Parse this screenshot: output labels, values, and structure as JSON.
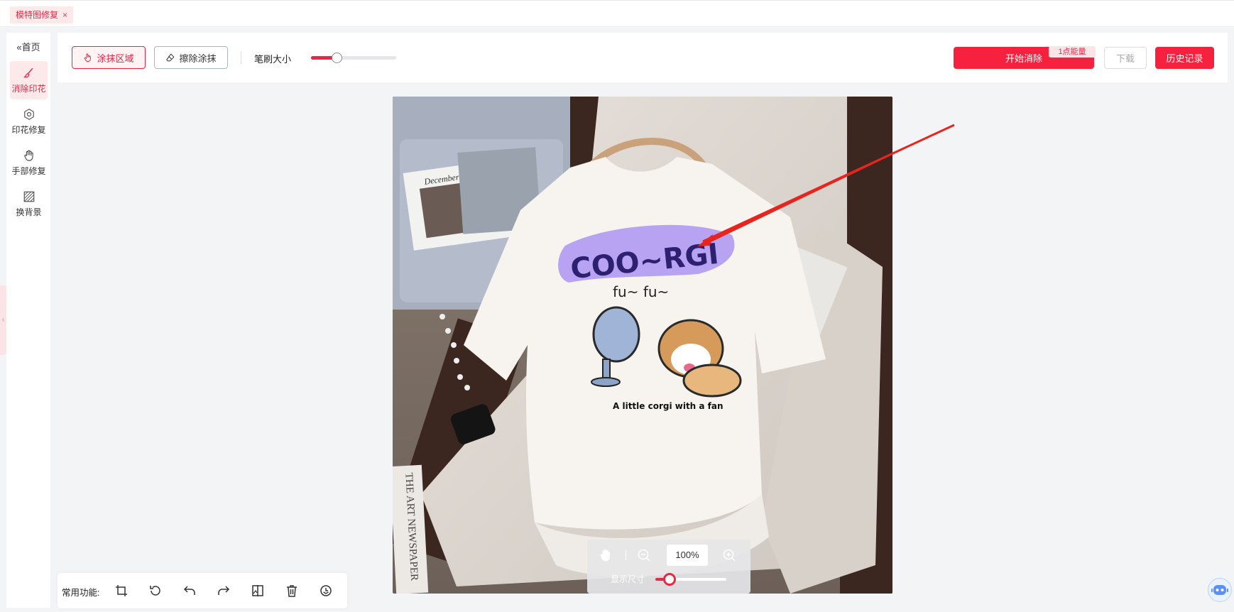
{
  "tabs": [
    {
      "label": "模特图修复",
      "close": "×"
    }
  ],
  "sidebar": {
    "home_label": "首页",
    "home_icon": "double-chevron-left-icon",
    "items": [
      {
        "label": "消除印花",
        "icon": "brush-icon",
        "active": true
      },
      {
        "label": "印花修复",
        "icon": "gear-icon",
        "active": false
      },
      {
        "label": "手部修复",
        "icon": "hand-icon",
        "active": false
      },
      {
        "label": "换背景",
        "icon": "background-icon",
        "active": false
      }
    ]
  },
  "toolbar": {
    "smear_label": "涂抹区域",
    "erase_label": "擦除涂抹",
    "brush_size_label": "笔刷大小",
    "brush_size_level": 0.3,
    "start_label": "开始消除",
    "energy_badge": "1点能量",
    "download_label": "下载",
    "history_label": "历史记录"
  },
  "zoom": {
    "value": "100%",
    "size_label": "显示尺寸",
    "size_level": 0.2
  },
  "functions": {
    "label": "常用功能:",
    "icons": [
      "crop-icon",
      "rotate-icon",
      "undo-icon",
      "redo-icon",
      "compare-icon",
      "delete-icon",
      "reset-icon"
    ]
  },
  "canvas_image": {
    "print_text_top": "COO~RGI",
    "print_text_mid": "fu~ fu~",
    "print_caption": "A little corgi with a fan",
    "magazine_text": "December",
    "newspaper_text": "THE ART NEWSPAPER"
  },
  "colors": {
    "accent": "#f5213f",
    "highlight": "#b39ef0",
    "background": "#f3f4f6"
  }
}
